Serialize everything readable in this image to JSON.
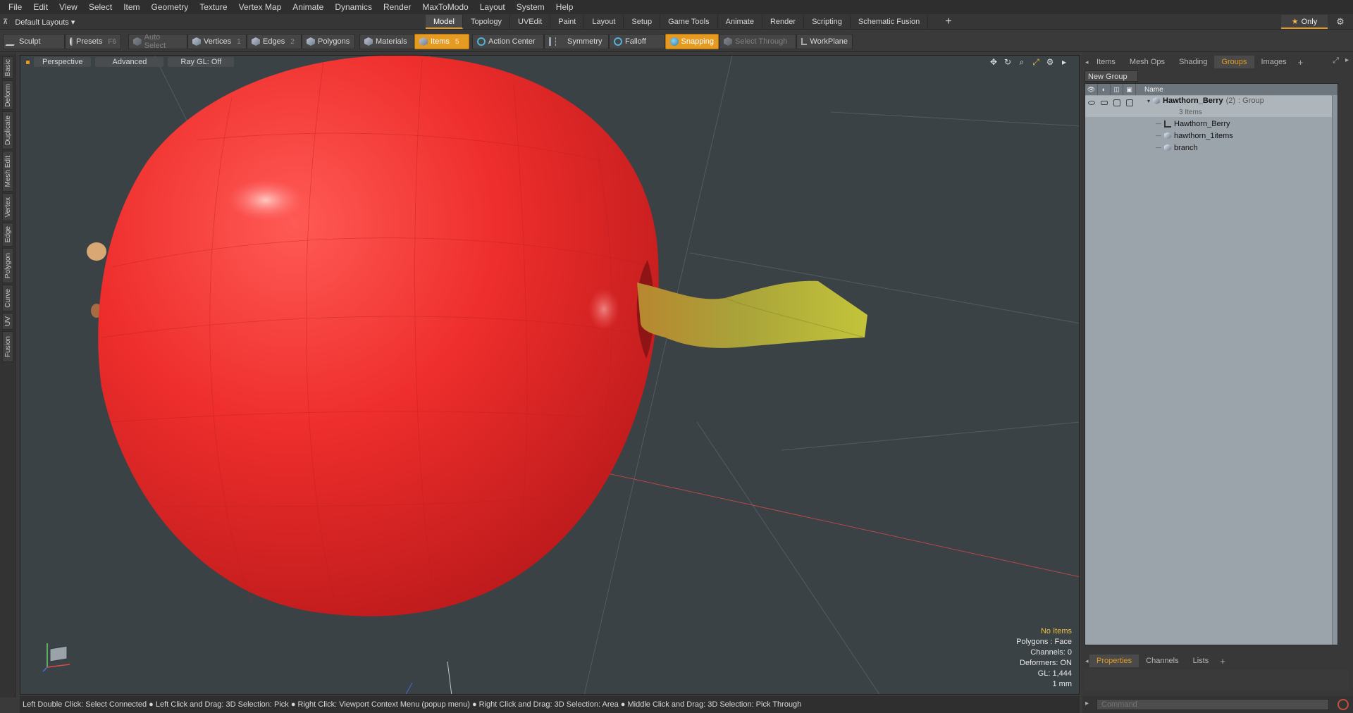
{
  "menu": [
    "File",
    "Edit",
    "View",
    "Select",
    "Item",
    "Geometry",
    "Texture",
    "Vertex Map",
    "Animate",
    "Dynamics",
    "Render",
    "MaxToModo",
    "Layout",
    "System",
    "Help"
  ],
  "layout_selector": "Default Layouts",
  "layout_tabs": [
    {
      "label": "Model",
      "active": true
    },
    {
      "label": "Topology"
    },
    {
      "label": "UVEdit"
    },
    {
      "label": "Paint"
    },
    {
      "label": "Layout"
    },
    {
      "label": "Setup"
    },
    {
      "label": "Game Tools"
    },
    {
      "label": "Animate"
    },
    {
      "label": "Render"
    },
    {
      "label": "Scripting"
    },
    {
      "label": "Schematic Fusion"
    }
  ],
  "add_layout": "+",
  "only_label": "Only",
  "toolbar": {
    "sculpt": "Sculpt",
    "presets": "Presets",
    "presets_key": "F6",
    "auto_select": "Auto Select",
    "vertices": "Vertices",
    "vertices_key": "1",
    "edges": "Edges",
    "edges_key": "2",
    "polygons": "Polygons",
    "materials": "Materials",
    "items": "Items",
    "items_key": "5",
    "action_center": "Action Center",
    "symmetry": "Symmetry",
    "falloff": "Falloff",
    "snapping": "Snapping",
    "select_through": "Select Through",
    "workplane": "WorkPlane"
  },
  "left_tabs": [
    "Basic",
    "Deform",
    "Duplicate",
    "Mesh Edit",
    "Vertex",
    "Edge",
    "Polygon",
    "Curve",
    "UV",
    "Fusion"
  ],
  "viewport": {
    "view_mode": "Perspective",
    "shading": "Advanced",
    "raygl": "Ray GL: Off",
    "info": {
      "no_items": "No Items",
      "polygons": "Polygons : Face",
      "channels": "Channels: 0",
      "deformers": "Deformers: ON",
      "gl": "GL: 1,444",
      "unit": "1 mm"
    }
  },
  "statusbar": "Left Double Click: Select Connected ● Left Click and Drag: 3D Selection: Pick ● Right Click: Viewport Context Menu (popup menu) ● Right Click and Drag: 3D Selection: Area ● Middle Click and Drag: 3D Selection: Pick Through",
  "right_panel": {
    "tabs": [
      {
        "label": "Items"
      },
      {
        "label": "Mesh Ops"
      },
      {
        "label": "Shading"
      },
      {
        "label": "Groups",
        "active": true
      },
      {
        "label": "Images"
      }
    ],
    "tab_add": "+",
    "new_group": "New Group",
    "name_col": "Name",
    "group": {
      "name": "Hawthorn_Berry",
      "count": "(2)",
      "type": ": Group",
      "sub": "3 Items"
    },
    "children": [
      {
        "name": "Hawthorn_Berry",
        "icon": "locator-icon"
      },
      {
        "name": "hawthorn_1items",
        "icon": "mesh-icon"
      },
      {
        "name": "branch",
        "icon": "mesh-icon"
      }
    ],
    "bottom_tabs": [
      {
        "label": "Properties",
        "active": true
      },
      {
        "label": "Channels"
      },
      {
        "label": "Lists"
      }
    ],
    "bottom_add": "+",
    "command_placeholder": "Command"
  },
  "colors": {
    "accent": "#e59a22",
    "berry": "#e8302e",
    "stem": "#b5b23a",
    "viewport_bg": "#3a4245"
  }
}
